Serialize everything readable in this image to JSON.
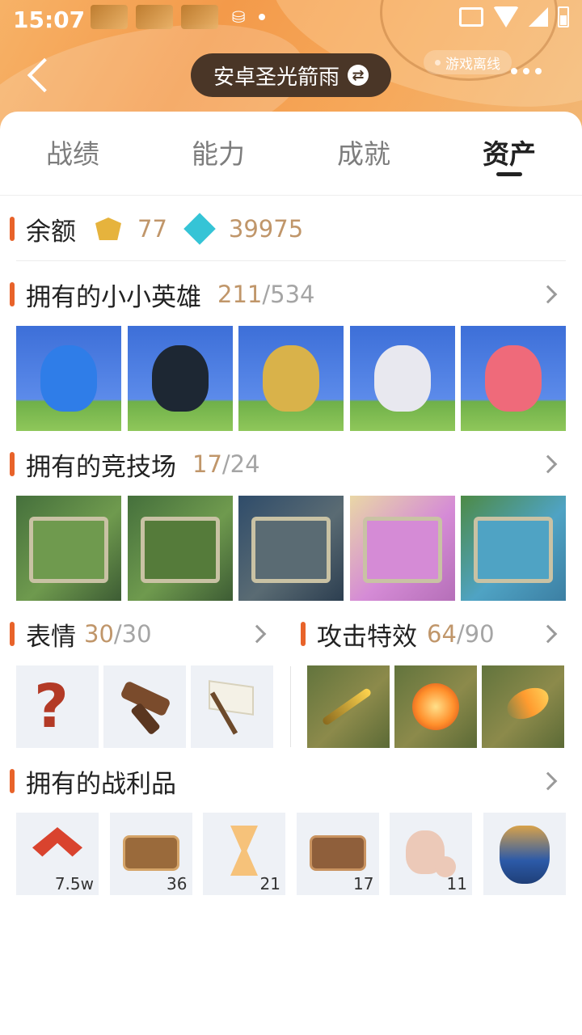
{
  "status_bar": {
    "time": "15:07"
  },
  "header": {
    "account_name": "安卓圣光箭雨",
    "status_badge": "游戏离线"
  },
  "tabs": [
    {
      "label": "战绩"
    },
    {
      "label": "能力"
    },
    {
      "label": "成就"
    },
    {
      "label": "资产",
      "active": true
    }
  ],
  "balance": {
    "title": "余额",
    "gold_value": "77",
    "gem_value": "39975",
    "gold_icon": "crest-coin-icon",
    "gem_icon": "gem-icon"
  },
  "heroes": {
    "title": "拥有的小小英雄",
    "owned": "211",
    "total": "/534",
    "items": [
      {
        "name": "blue-slime",
        "color": "#2f7de8"
      },
      {
        "name": "penguin",
        "color": "#1d2733"
      },
      {
        "name": "dragon-cat",
        "color": "#d9b24a"
      },
      {
        "name": "white-tiger",
        "color": "#e8e8ef"
      },
      {
        "name": "pink-dragon",
        "color": "#ef6a7a"
      }
    ]
  },
  "arenas": {
    "title": "拥有的竞技场",
    "owned": "17",
    "total": "/24",
    "items": [
      {
        "name": "jungle-swirl",
        "color": "#6f9a4e"
      },
      {
        "name": "jungle-ruins",
        "color": "#557b3a"
      },
      {
        "name": "clockwork",
        "color": "#5a6b73"
      },
      {
        "name": "pink-crystal",
        "color": "#d58bd6"
      },
      {
        "name": "ocean-stone",
        "color": "#4fa3c4"
      }
    ]
  },
  "emotes": {
    "title": "表情",
    "owned": "30",
    "total": "/30",
    "items": [
      "question-mark-icon",
      "hammer-icon",
      "white-flag-icon"
    ]
  },
  "attack_effects": {
    "title": "攻击特效",
    "owned": "64",
    "total": "/90",
    "items": [
      "golden-arrow",
      "fire-burst",
      "meteor"
    ]
  },
  "loot": {
    "title": "拥有的战利品",
    "items": [
      {
        "icon": "rank-chevron-icon",
        "count": "7.5w"
      },
      {
        "icon": "x2-token-icon",
        "count": "36"
      },
      {
        "icon": "hourglass-icon",
        "count": "21"
      },
      {
        "icon": "x2-rank-token-icon",
        "count": "17"
      },
      {
        "icon": "coin-bag-icon",
        "count": "11"
      },
      {
        "icon": "treasure-bag-icon",
        "count": ""
      }
    ]
  },
  "colors": {
    "accent_bar": "#e8632a",
    "count_owned": "#c0966a",
    "count_total": "#a5a5a5",
    "header_orange": "#f39a4a",
    "pill_bg": "#4a3627"
  }
}
